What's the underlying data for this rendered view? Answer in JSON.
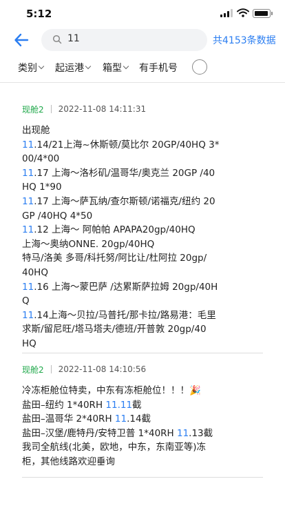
{
  "status": {
    "time": "5:12"
  },
  "search": {
    "query": "11",
    "total_text": "共4153条数据"
  },
  "filters": [
    "类别",
    "起运港",
    "箱型",
    "有手机号"
  ],
  "posts": [
    {
      "tag": "现舱2",
      "time": "2022-11-08 14:11:31",
      "lines": [
        [
          {
            "t": "出现舱"
          }
        ],
        [
          {
            "t": "11",
            "hl": true
          },
          {
            "t": ".14/21上海~休斯顿/莫比尔 20GP/40HQ 3*"
          }
        ],
        [
          {
            "t": "00/4*00"
          }
        ],
        [
          {
            "t": "11",
            "hl": true
          },
          {
            "t": ".17 上海～洛杉矶/温哥华/奥克兰 20GP /40"
          }
        ],
        [
          {
            "t": "HQ 1*90"
          }
        ],
        [
          {
            "t": "11",
            "hl": true
          },
          {
            "t": ".17 上海～萨瓦纳/查尔斯顿/诺福克/纽约 20"
          }
        ],
        [
          {
            "t": "GP /40HQ 4*50"
          }
        ],
        [
          {
            "t": "11",
            "hl": true
          },
          {
            "t": ".12 上海～ 阿帕帕 APAPA20gp/40HQ"
          }
        ],
        [
          {
            "t": "上海～奥纳ONNE. 20gp/40HQ"
          }
        ],
        [
          {
            "t": "特马/洛美 多哥/科托努/阿比让/杜阿拉 20gp/"
          }
        ],
        [
          {
            "t": "40HQ"
          }
        ],
        [
          {
            "t": "11",
            "hl": true
          },
          {
            "t": ".16 上海～蒙巴萨 /达累斯萨拉姆 20gp/40H"
          }
        ],
        [
          {
            "t": "Q"
          }
        ],
        [
          {
            "t": "11",
            "hl": true
          },
          {
            "t": ".14上海～贝拉/马普托/那卡拉/路易港：毛里"
          }
        ],
        [
          {
            "t": "求斯/留尼旺/塔马塔夫/德班/开普敦 20gp/40"
          }
        ],
        [
          {
            "t": "HQ"
          }
        ]
      ]
    },
    {
      "tag": "现舱2",
      "time": "2022-11-08 14:10:56",
      "lines": [
        [
          {
            "t": "冷冻柜舱位特卖，中东有冻柜舱位！！！🎉"
          }
        ],
        [
          {
            "t": "盐田–纽约 1*40RH "
          },
          {
            "t": "11.11",
            "hl": true
          },
          {
            "t": "截"
          }
        ],
        [
          {
            "t": "盐田–温哥华 2*40RH "
          },
          {
            "t": "11",
            "hl": true
          },
          {
            "t": ".14截"
          }
        ],
        [
          {
            "t": "盐田–汉堡/鹿特丹/安特卫普 1*40RH "
          },
          {
            "t": "11",
            "hl": true
          },
          {
            "t": ".13截"
          }
        ],
        [
          {
            "t": "我司全航线(北美，欧地，中东，东南亚等)冻"
          }
        ],
        [
          {
            "t": "柜，其他线路欢迎垂询"
          }
        ]
      ]
    }
  ]
}
